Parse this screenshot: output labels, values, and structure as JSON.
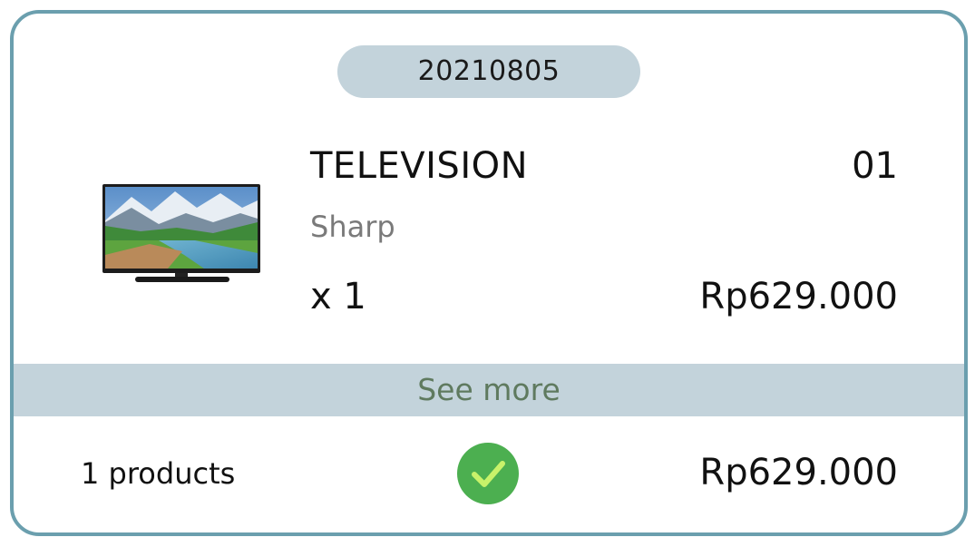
{
  "order": {
    "code": "20210805"
  },
  "item": {
    "name": "TELEVISION",
    "index": "01",
    "brand": "Sharp",
    "quantity": "x 1",
    "price": "Rp629.000",
    "image_icon": "television-icon"
  },
  "actions": {
    "see_more_label": "See more"
  },
  "summary": {
    "product_count": "1 products",
    "total": "Rp629.000",
    "status_icon": "check-circle-icon",
    "status_color": "#4caf50"
  },
  "colors": {
    "border": "#6b9fae",
    "pill_background": "#c3d3db",
    "see_more_text": "#5f7a5f",
    "brand_text": "#7a7a7a"
  }
}
